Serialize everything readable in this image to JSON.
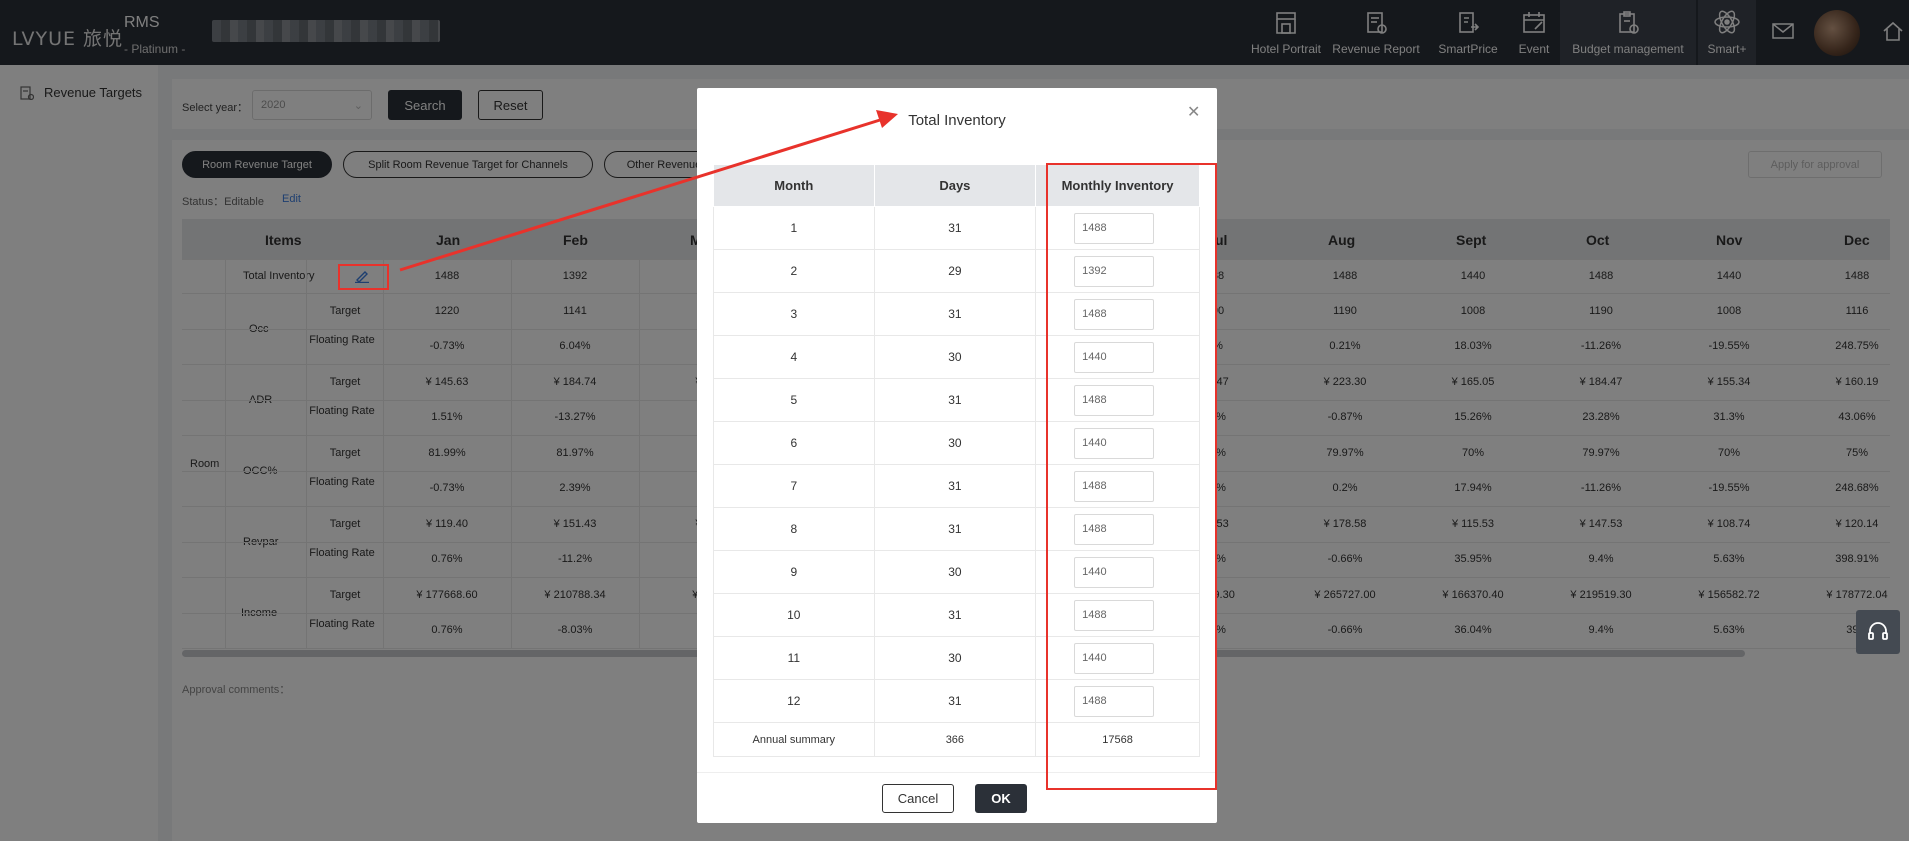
{
  "header": {
    "logo_text": "LVYUE 旅悦",
    "app_name": "RMS",
    "plan": "- Platinum -",
    "nav": [
      {
        "label": "Hotel Portrait",
        "icon": "storefront-icon"
      },
      {
        "label": "Revenue Report",
        "icon": "report-icon"
      },
      {
        "label": "SmartPrice",
        "icon": "price-icon"
      },
      {
        "label": "Event",
        "icon": "calendar-icon"
      },
      {
        "label": "Budget management",
        "icon": "clipboard-gear-icon"
      },
      {
        "label": "Smart+",
        "icon": "atom-icon"
      }
    ],
    "mail_icon": "mail-icon",
    "home_icon": "home-icon"
  },
  "sidebar": {
    "items": [
      {
        "label": "Revenue Targets",
        "icon": "targets-icon"
      }
    ]
  },
  "filter": {
    "year_label": "Select year：",
    "year_value": "2020",
    "search_label": "Search",
    "reset_label": "Reset"
  },
  "tabs": [
    {
      "label": "Room Revenue Target"
    },
    {
      "label": "Split Room Revenue Target for Channels"
    },
    {
      "label": "Other Revenue"
    }
  ],
  "apply_label": "Apply for approval",
  "status": {
    "label": "Status：Editable",
    "edit_label": "Edit"
  },
  "grid": {
    "items_header": "Items",
    "months": [
      "Jan",
      "Feb",
      "M",
      "ul",
      "Aug",
      "Sept",
      "Oct",
      "Nov",
      "Dec"
    ],
    "room_label": "Room",
    "total_inventory_label": "Total Inventory",
    "groups": [
      "Occ",
      "ADR",
      "OCC%",
      "Revpar",
      "Income"
    ],
    "sub_target": "Target",
    "sub_floating": "Floating Rate",
    "columns": [
      [
        "1488",
        "1220",
        "-0.73%",
        "¥ 145.63",
        "1.51%",
        "81.99%",
        "-0.73%",
        "¥ 119.40",
        "0.76%",
        "¥ 177668.60",
        "0.76%"
      ],
      [
        "1392",
        "1141",
        "6.04%",
        "¥ 184.74",
        "-13.27%",
        "81.97%",
        "2.39%",
        "¥ 151.43",
        "-11.2%",
        "¥ 210788.34",
        "-8.03%"
      ],
      [
        "1",
        "1",
        "1.",
        "¥ 1",
        "9.",
        "69",
        "1.",
        "¥ 1",
        "10",
        "¥ 17",
        "11"
      ],
      [
        "38",
        "90",
        "%",
        "4.47",
        "7%",
        "7%",
        "3%",
        "7.53",
        "1%",
        "519.30",
        "7%"
      ],
      [
        "1488",
        "1190",
        "0.21%",
        "¥ 223.30",
        "-0.87%",
        "79.97%",
        "0.2%",
        "¥ 178.58",
        "-0.66%",
        "¥ 265727.00",
        "-0.66%"
      ],
      [
        "1440",
        "1008",
        "18.03%",
        "¥ 165.05",
        "15.26%",
        "70%",
        "17.94%",
        "¥ 115.53",
        "35.95%",
        "¥ 166370.40",
        "36.04%"
      ],
      [
        "1488",
        "1190",
        "-11.26%",
        "¥ 184.47",
        "23.28%",
        "79.97%",
        "-11.26%",
        "¥ 147.53",
        "9.4%",
        "¥ 219519.30",
        "9.4%"
      ],
      [
        "1440",
        "1008",
        "-19.55%",
        "¥ 155.34",
        "31.3%",
        "70%",
        "-19.55%",
        "¥ 108.74",
        "5.63%",
        "¥ 156582.72",
        "5.63%"
      ],
      [
        "1488",
        "1116",
        "248.75%",
        "¥ 160.19",
        "43.06%",
        "75%",
        "248.68%",
        "¥ 120.14",
        "398.91%",
        "¥ 178772.04",
        "398."
      ]
    ],
    "approval_label": "Approval comments："
  },
  "modal": {
    "title": "Total Inventory",
    "close_icon": "close-icon",
    "headers": [
      "Month",
      "Days",
      "Monthly Inventory"
    ],
    "rows": [
      {
        "month": "1",
        "days": "31",
        "inventory": "1488"
      },
      {
        "month": "2",
        "days": "29",
        "inventory": "1392"
      },
      {
        "month": "3",
        "days": "31",
        "inventory": "1488"
      },
      {
        "month": "4",
        "days": "30",
        "inventory": "1440"
      },
      {
        "month": "5",
        "days": "31",
        "inventory": "1488"
      },
      {
        "month": "6",
        "days": "30",
        "inventory": "1440"
      },
      {
        "month": "7",
        "days": "31",
        "inventory": "1488"
      },
      {
        "month": "8",
        "days": "31",
        "inventory": "1488"
      },
      {
        "month": "9",
        "days": "30",
        "inventory": "1440"
      },
      {
        "month": "10",
        "days": "31",
        "inventory": "1488"
      },
      {
        "month": "11",
        "days": "30",
        "inventory": "1440"
      },
      {
        "month": "12",
        "days": "31",
        "inventory": "1488"
      }
    ],
    "summary": {
      "label": "Annual summary",
      "days": "366",
      "inventory": "17568"
    },
    "cancel_label": "Cancel",
    "ok_label": "OK"
  },
  "colors": {
    "header_bg": "#2b3038",
    "annotation_red": "#e8322b",
    "link_blue": "#3d7ee0"
  }
}
